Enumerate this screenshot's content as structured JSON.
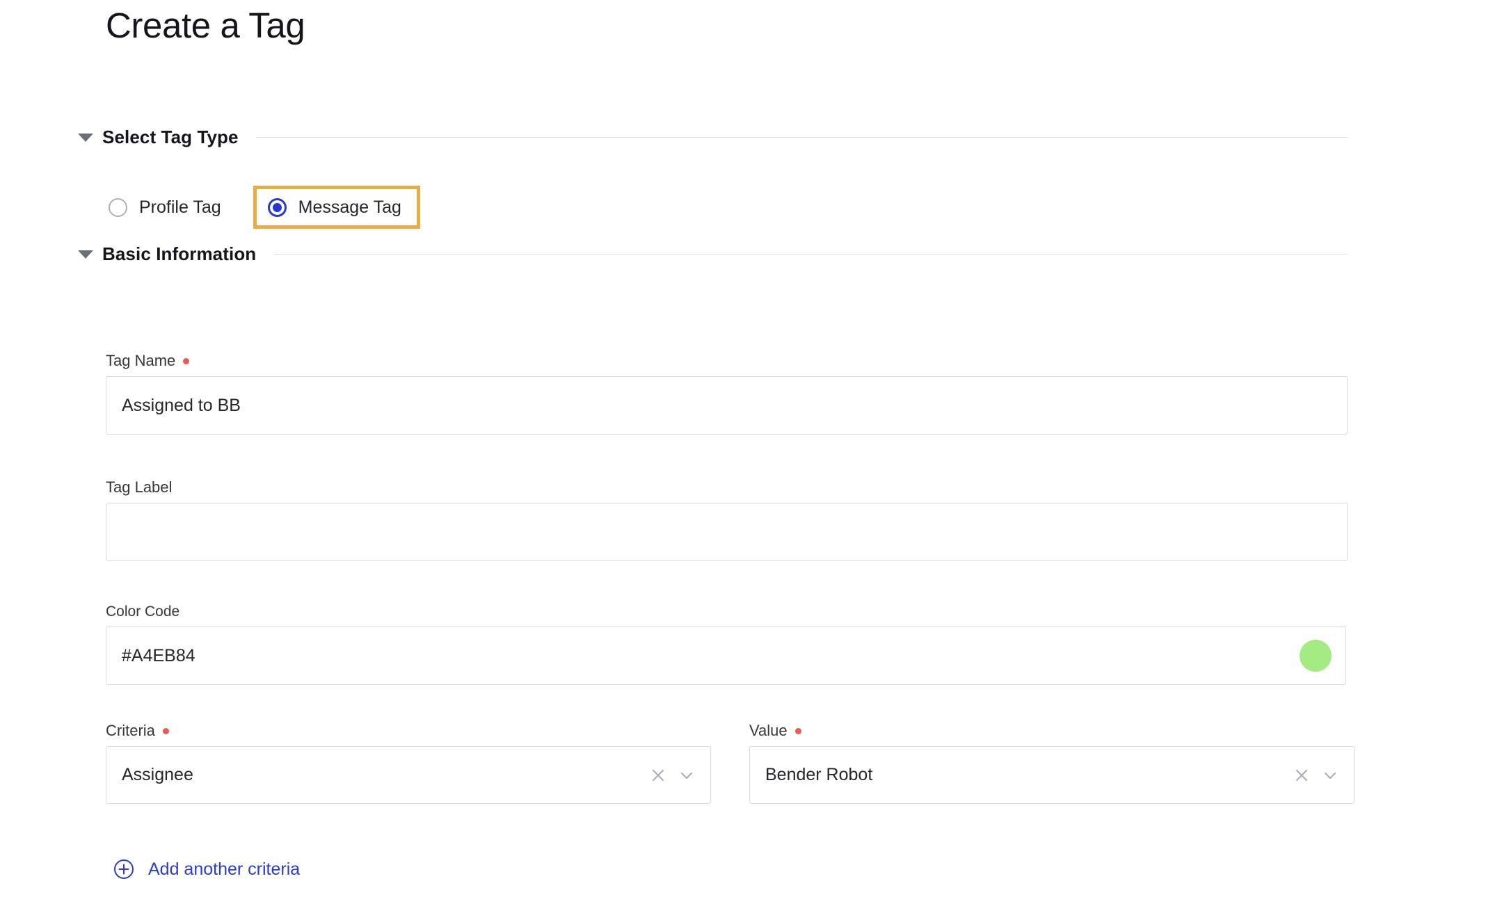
{
  "page": {
    "title": "Create a Tag"
  },
  "sections": {
    "tag_type": {
      "title": "Select Tag Type",
      "caret_icon": "caret-down-icon",
      "options": [
        {
          "label": "Profile Tag",
          "selected": false
        },
        {
          "label": "Message Tag",
          "selected": true
        }
      ],
      "highlight_color": "#E8AD44",
      "selected_radio_color": "#2637D4"
    },
    "basic_information": {
      "title": "Basic Information",
      "caret_icon": "caret-down-icon",
      "fields": {
        "tag_name": {
          "label": "Tag Name",
          "required": true,
          "value": "Assigned to BB",
          "placeholder": ""
        },
        "tag_label": {
          "label": "Tag Label",
          "required": false,
          "value": "",
          "placeholder": ""
        },
        "color_code": {
          "label": "Color Code",
          "required": false,
          "value": "#A4EB84",
          "placeholder": "",
          "swatch_color": "#A4EB84"
        },
        "criteria": {
          "label": "Criteria",
          "required": true,
          "value": "Assignee",
          "clear_icon": "close-icon",
          "dropdown_icon": "chevron-down-icon"
        },
        "value": {
          "label": "Value",
          "required": true,
          "value": "Bender Robot",
          "clear_icon": "close-icon",
          "dropdown_icon": "chevron-down-icon"
        }
      },
      "add_criteria": {
        "label": "Add another criteria",
        "icon": "plus-circle-icon",
        "color": "#2D3BD6"
      }
    }
  },
  "colors": {
    "required_dot": "#EE5A52",
    "input_border": "#D9DADF",
    "divider": "#DEDFE4",
    "text_primary": "#1D1E23"
  }
}
